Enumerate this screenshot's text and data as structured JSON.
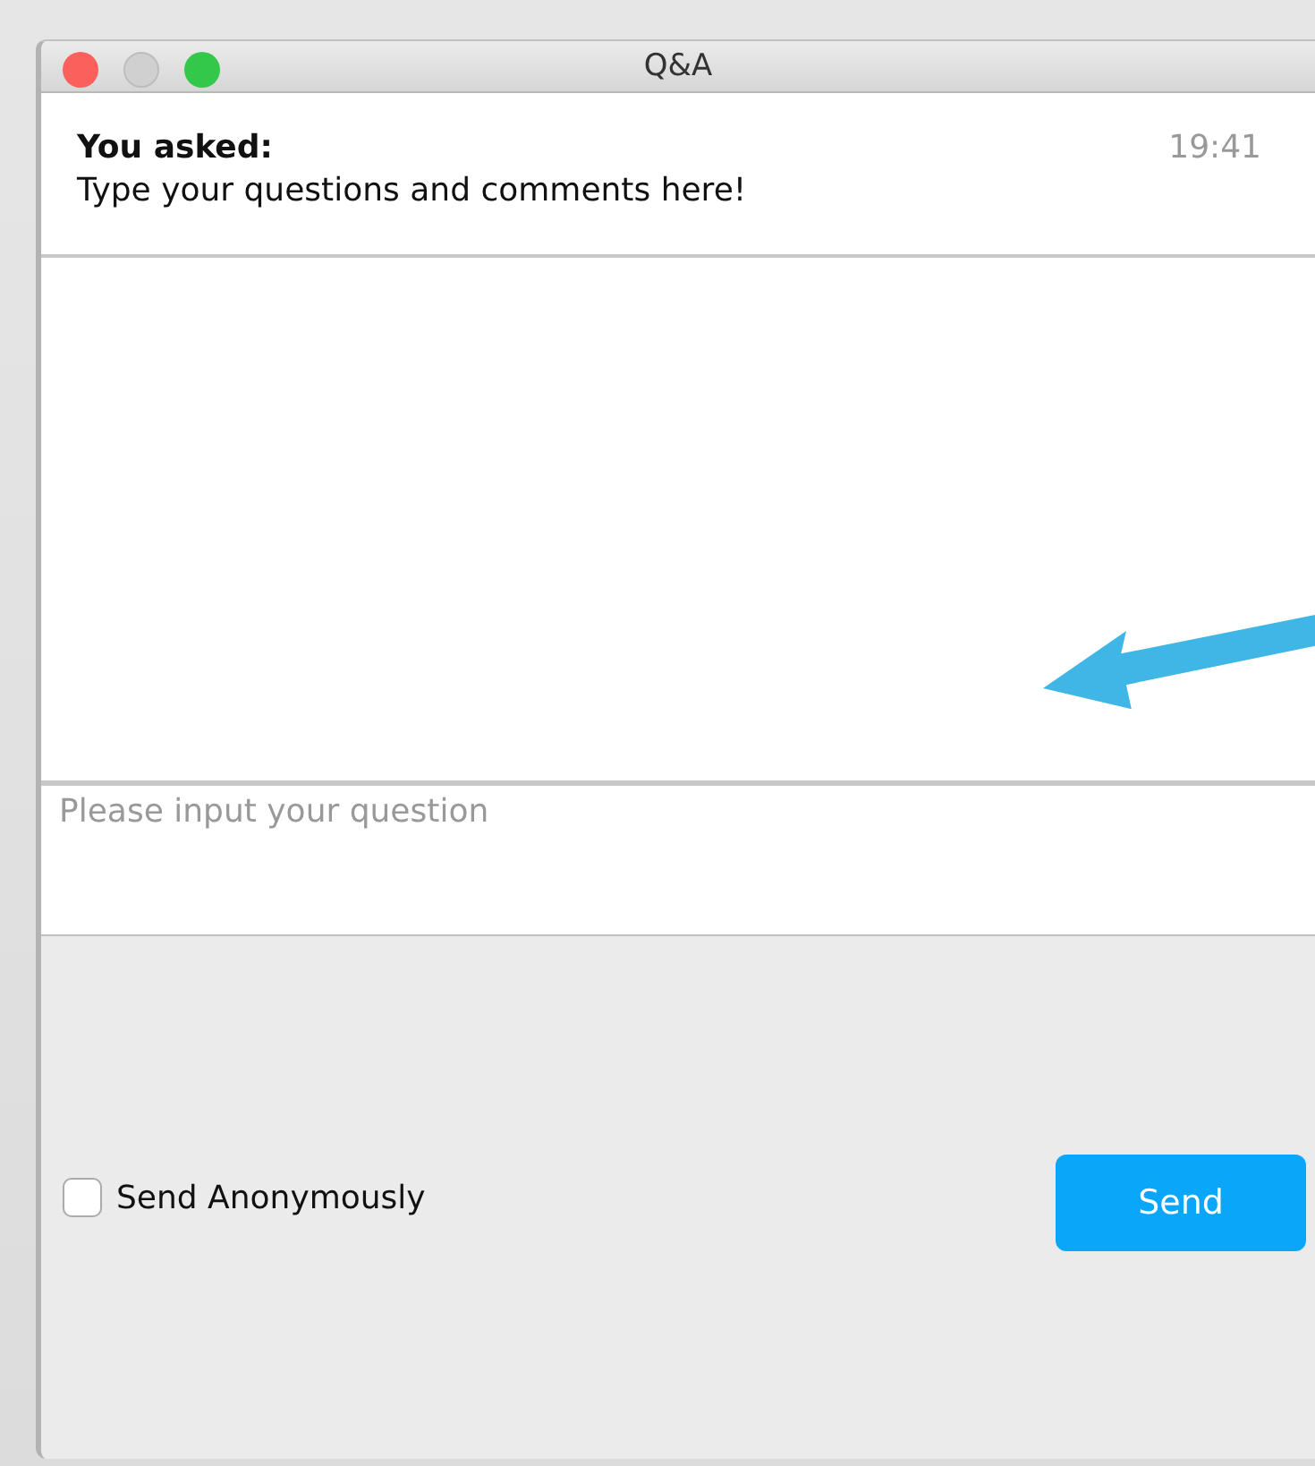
{
  "window": {
    "title": "Q&A"
  },
  "message": {
    "heading": "You asked:",
    "time": "19:41",
    "text": "Type your questions and comments here!"
  },
  "question_input": {
    "placeholder": "Please input your question"
  },
  "anonymous": {
    "label": "Send Anonymously",
    "checked": false
  },
  "send_button": {
    "label": "Send"
  }
}
